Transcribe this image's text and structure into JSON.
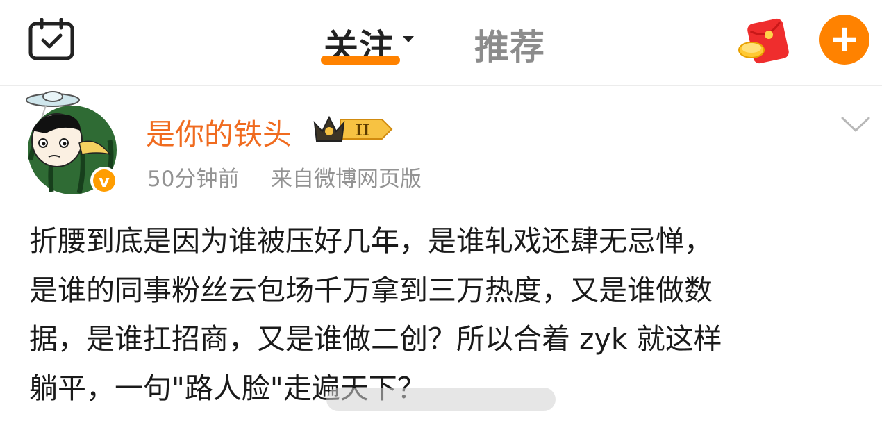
{
  "header": {
    "tab_follow": "关注",
    "tab_recommend": "推荐",
    "add_label": "+",
    "icons": [
      "calendar-check-icon",
      "chevron-down-icon",
      "red-packet-icon",
      "plus-icon"
    ],
    "accent_color": "#ff8200"
  },
  "post": {
    "username": "是你的铁头",
    "level_badge": "II",
    "time": "50分钟前",
    "source": "来自微博网页版",
    "username_color": "#f06b1f",
    "lines": [
      "折腰到底是因为谁被压好几年，是谁轧戏还肆无忌惮，",
      "是谁的同事粉丝云包场千万拿到三万热度，又是谁做数",
      "据，是谁扛招商，又是谁做二创？所以合着 zyk 就这样",
      "躺平，一句\"路人脸\"走遍天下？"
    ]
  }
}
